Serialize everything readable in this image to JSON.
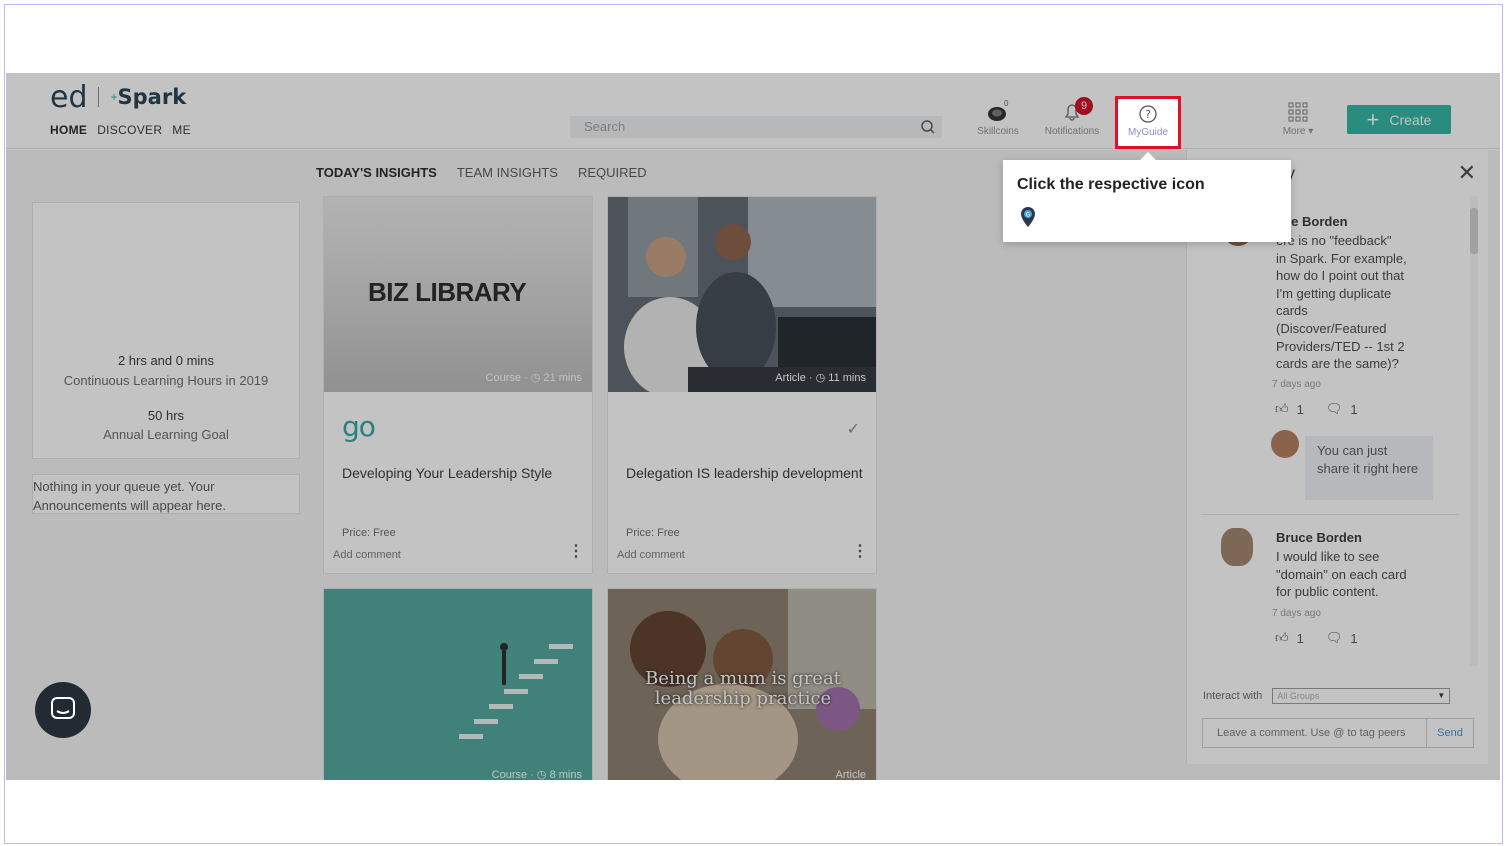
{
  "header": {
    "logo_ed": "ed",
    "logo_spark": "Spark",
    "nav": [
      {
        "label": "HOME",
        "active": true
      },
      {
        "label": "DISCOVER",
        "active": false
      },
      {
        "label": "ME",
        "active": false
      }
    ],
    "search_placeholder": "Search",
    "icons": {
      "skillcoins": {
        "label": "Skillcoins",
        "count": "0"
      },
      "notifications": {
        "label": "Notifications",
        "badge": "9"
      },
      "myguide": {
        "label": "MyGuide"
      },
      "more": {
        "label": "More"
      }
    },
    "create_label": "Create",
    "accent": "#2bb3a0"
  },
  "tabs": [
    {
      "label": "TODAY'S INSIGHTS",
      "active": true
    },
    {
      "label": "TEAM INSIGHTS",
      "active": false
    },
    {
      "label": "REQUIRED",
      "active": false
    }
  ],
  "stats": {
    "hours": "2 hrs and 0 mins",
    "hours_label": "Continuous Learning Hours in 2019",
    "goal": "50 hrs",
    "goal_label": "Annual Learning Goal"
  },
  "queue_message": "Nothing in your queue yet. Your Announcements will appear here.",
  "cards": [
    {
      "image_text": "BIZ LIBRARY",
      "type": "Course",
      "duration": "21 mins",
      "logo": "go",
      "title": "Developing Your Leadership Style",
      "price": "Price: Free",
      "add_comment": "Add comment"
    },
    {
      "type": "Article",
      "duration": "11 mins",
      "title": "Delegation IS leadership development",
      "price": "Price: Free",
      "add_comment": "Add comment"
    },
    {
      "type": "Course",
      "duration": "8 mins"
    },
    {
      "image_text": "Being a mum is great leadership practice",
      "type": "Article"
    }
  ],
  "panel": {
    "title_fragment": "y",
    "comments": [
      {
        "name": "Bruce Borden",
        "name_visible": "uce Borden",
        "text": [
          "ere is no \"feedback\"",
          "in Spark. For example,",
          "how do I point out that",
          "I'm getting duplicate",
          "cards",
          "(Discover/Featured",
          "Providers/TED -- 1st 2",
          "cards are the same)?"
        ],
        "age": "7 days ago",
        "likes": "1",
        "replies": "1",
        "reply": "You can just share it right here"
      },
      {
        "name": "Bruce Borden",
        "text": [
          "I would like to see",
          "\"domain\" on each card",
          "for public content."
        ],
        "age": "7 days ago",
        "likes": "1",
        "replies": "1"
      }
    ],
    "interact_label": "Interact with",
    "groups_value": "All Groups",
    "comment_placeholder": "Leave a comment. Use @ to tag peers",
    "send_label": "Send"
  },
  "tooltip": {
    "text": "Click the respective icon"
  }
}
